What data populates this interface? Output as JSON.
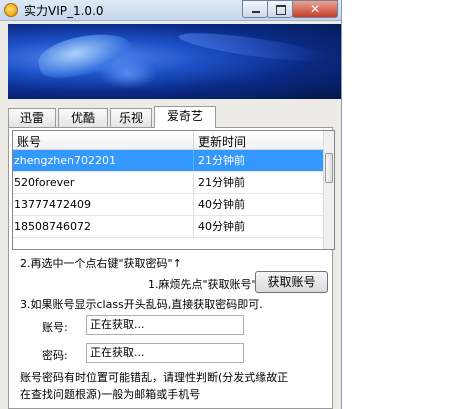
{
  "window": {
    "title": "实力VIP_1.0.0",
    "close_glyph": "✕"
  },
  "tabs": [
    "迅雷",
    "优酷",
    "乐视",
    "爱奇艺"
  ],
  "active_tab": "爱奇艺",
  "table": {
    "columns": [
      "账号",
      "更新时间"
    ],
    "rows": [
      [
        "zhengzhen702201",
        "21分钟前"
      ],
      [
        "520forever",
        "21分钟前"
      ],
      [
        "13777472409",
        "40分钟前"
      ],
      [
        "18508746072",
        "40分钟前"
      ]
    ],
    "selected_row": 0
  },
  "instructions": {
    "step2": "2.再选中一个点右键\"获取密码\"↑",
    "step1": "1.麻烦先点\"获取账号\"→",
    "step3": "3.如果账号显示class开头乱码,直接获取密码即可."
  },
  "get_account_button": "获取账号",
  "form": {
    "account_label": "账号:",
    "account_value": "正在获取...",
    "password_label": "密码:",
    "password_value": "正在获取..."
  },
  "footer_note_line1": "账号密码有时位置可能错乱，请理性判断(分发式缘故正",
  "footer_note_line2": "在查找问题根源)一般为邮箱或手机号",
  "colors": {
    "selection": "#3399ff",
    "close_button": "#c6402a"
  }
}
